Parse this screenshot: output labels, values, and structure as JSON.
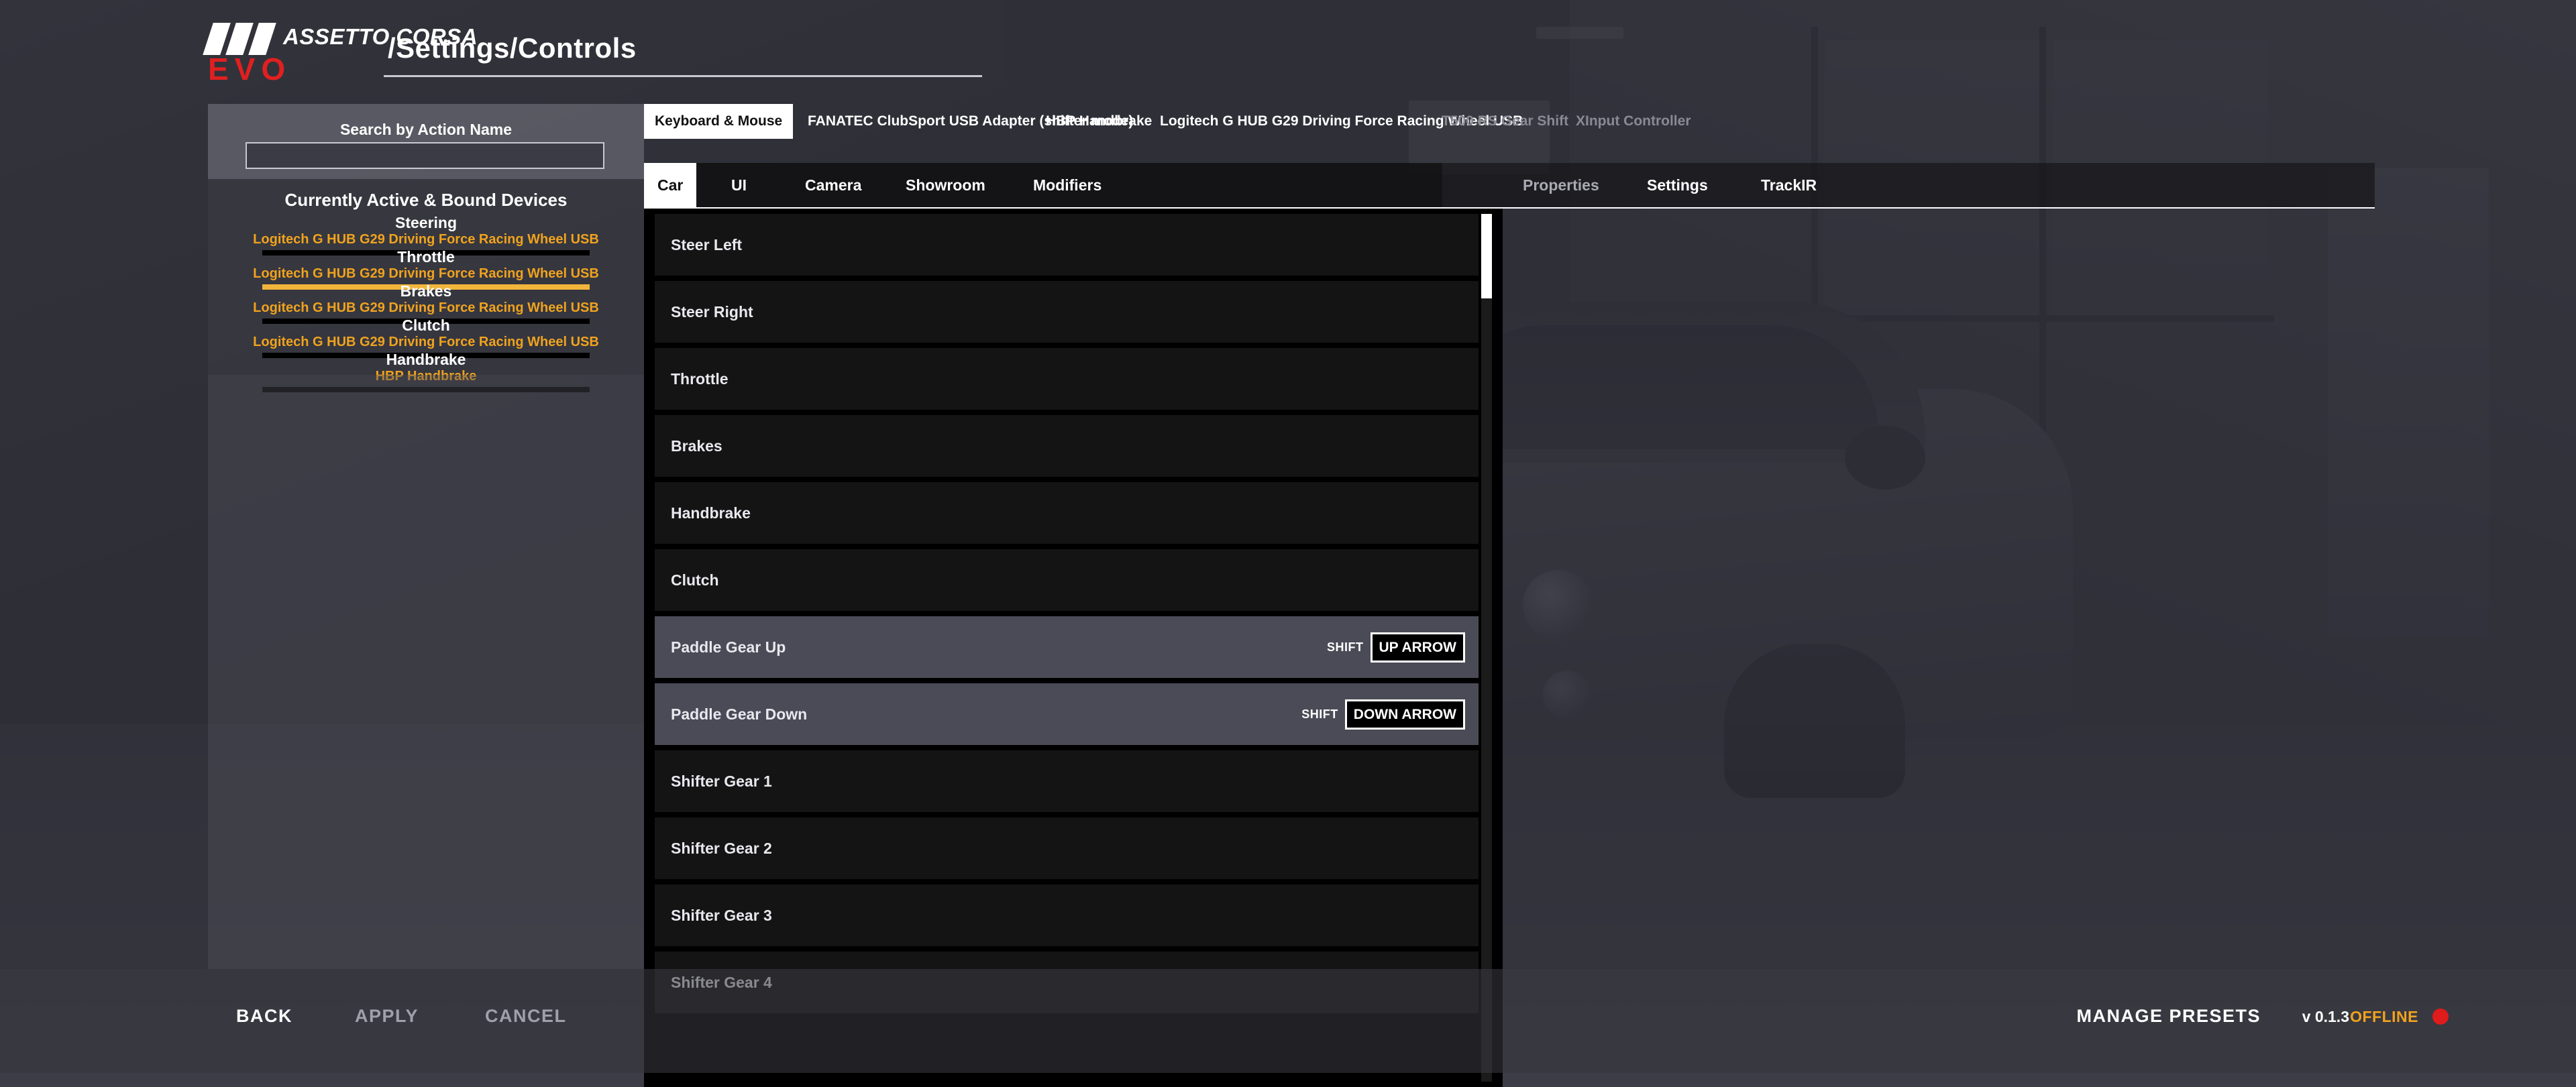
{
  "app": {
    "brand_line1": "ASSETTO CORSA",
    "brand_line2": "EVO",
    "page_title": "/Settings/Controls",
    "accent_yellow": "#f0a31e",
    "accent_red": "#e02020"
  },
  "sidebar": {
    "search": {
      "label": "Search by Action Name",
      "value": "",
      "placeholder": ""
    },
    "devices_title": "Currently Active & Bound Devices",
    "devices": [
      {
        "name": "Steering",
        "source": "Logitech G HUB G29 Driving Force Racing Wheel USB",
        "level": 0
      },
      {
        "name": "Throttle",
        "source": "Logitech G HUB G29 Driving Force Racing Wheel USB",
        "level": 100
      },
      {
        "name": "Brakes",
        "source": "Logitech G HUB G29 Driving Force Racing Wheel USB",
        "level": 0
      },
      {
        "name": "Clutch",
        "source": "Logitech G HUB G29 Driving Force Racing Wheel USB",
        "level": 0
      },
      {
        "name": "Handbrake",
        "source": "HBP Handbrake",
        "level": 0
      }
    ]
  },
  "device_tabs": [
    {
      "label": "Keyboard & Mouse",
      "state": "active"
    },
    {
      "label": "FANATEC ClubSport USB Adapter (shifter mode)",
      "state": "normal"
    },
    {
      "label": "HBP Handbrake",
      "state": "normal"
    },
    {
      "label": "Logitech G HUB G29 Driving Force Racing Wheel USB",
      "state": "normal"
    },
    {
      "label": "T500 RS Gear Shift",
      "state": "disabled"
    },
    {
      "label": "XInput Controller",
      "state": "disabled"
    }
  ],
  "category_tabs_left": [
    {
      "label": "Car",
      "state": "active"
    },
    {
      "label": "UI",
      "state": "normal"
    },
    {
      "label": "Camera",
      "state": "normal"
    },
    {
      "label": "Showroom",
      "state": "normal"
    },
    {
      "label": "Modifiers",
      "state": "normal"
    }
  ],
  "category_tabs_right": [
    {
      "label": "Properties",
      "state": "dim"
    },
    {
      "label": "Settings",
      "state": "normal"
    },
    {
      "label": "TrackIR",
      "state": "normal"
    }
  ],
  "actions": [
    {
      "name": "Steer Left",
      "modifier": "",
      "key": "",
      "bound": false
    },
    {
      "name": "Steer Right",
      "modifier": "",
      "key": "",
      "bound": false
    },
    {
      "name": "Throttle",
      "modifier": "",
      "key": "",
      "bound": false
    },
    {
      "name": "Brakes",
      "modifier": "",
      "key": "",
      "bound": false
    },
    {
      "name": "Handbrake",
      "modifier": "",
      "key": "",
      "bound": false
    },
    {
      "name": "Clutch",
      "modifier": "",
      "key": "",
      "bound": false
    },
    {
      "name": "Paddle Gear Up",
      "modifier": "SHIFT",
      "key": "UP ARROW",
      "bound": true
    },
    {
      "name": "Paddle Gear Down",
      "modifier": "SHIFT",
      "key": "DOWN ARROW",
      "bound": true
    },
    {
      "name": "Shifter Gear 1",
      "modifier": "",
      "key": "",
      "bound": false
    },
    {
      "name": "Shifter Gear 2",
      "modifier": "",
      "key": "",
      "bound": false
    },
    {
      "name": "Shifter Gear 3",
      "modifier": "",
      "key": "",
      "bound": false
    },
    {
      "name": "Shifter Gear 4",
      "modifier": "",
      "key": "",
      "bound": false
    }
  ],
  "bottom": {
    "back": "BACK",
    "apply": "APPLY",
    "cancel": "CANCEL",
    "manage_presets": "MANAGE PRESETS",
    "version": "v 0.1.3",
    "status": "OFFLINE"
  }
}
